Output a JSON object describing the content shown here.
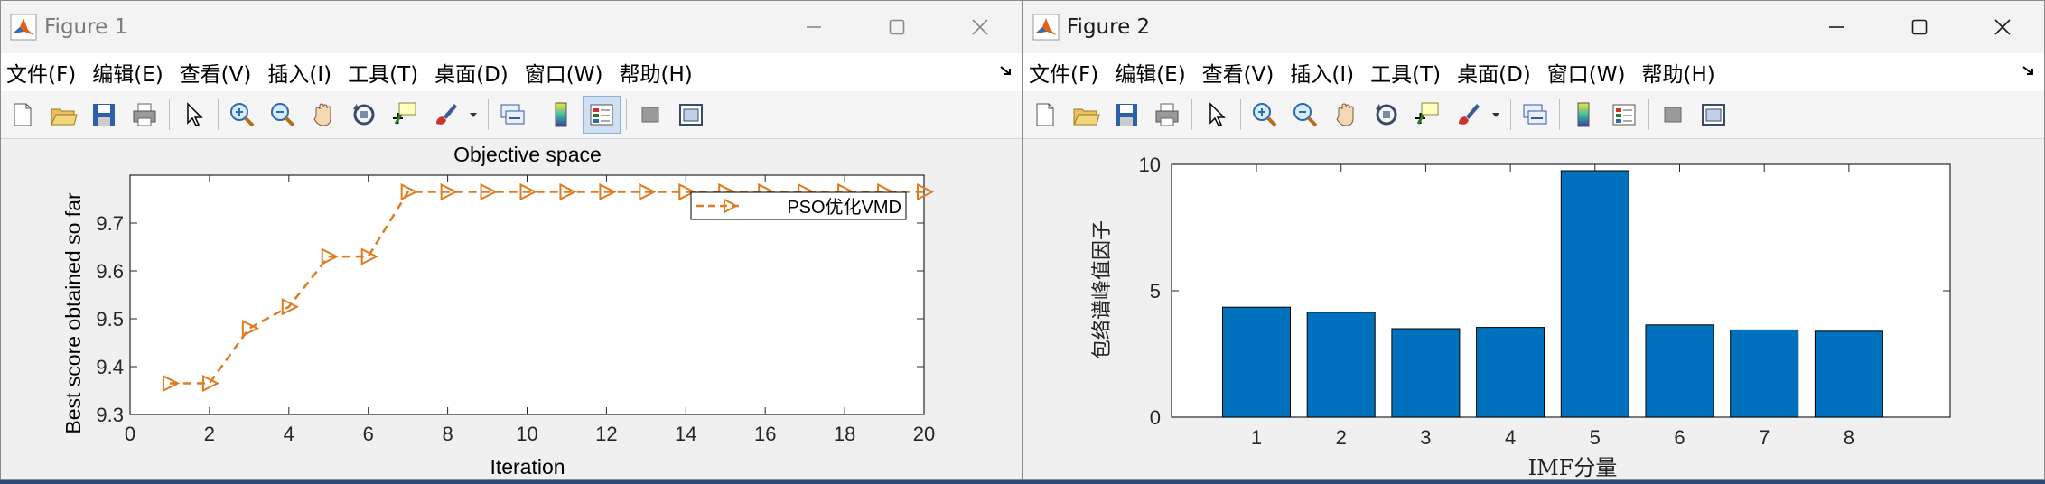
{
  "windows": [
    {
      "title": "Figure 1",
      "menu": [
        "文件(F)",
        "编辑(E)",
        "查看(V)",
        "插入(I)",
        "工具(T)",
        "桌面(D)",
        "窗口(W)",
        "帮助(H)"
      ],
      "toolbar_icons": [
        "new-figure-icon",
        "open-file-icon",
        "save-icon",
        "print-icon",
        "pointer-icon",
        "zoom-in-icon",
        "zoom-out-icon",
        "pan-icon",
        "rotate-3d-icon",
        "data-cursor-icon",
        "brush-icon",
        "link-plot-icon",
        "colorbar-icon",
        "legend-icon",
        "hide-plot-tools-icon",
        "show-plot-tools-icon"
      ]
    },
    {
      "title": "Figure 2",
      "menu": [
        "文件(F)",
        "编辑(E)",
        "查看(V)",
        "插入(I)",
        "工具(T)",
        "桌面(D)",
        "窗口(W)",
        "帮助(H)"
      ],
      "toolbar_icons": [
        "new-figure-icon",
        "open-file-icon",
        "save-icon",
        "print-icon",
        "pointer-icon",
        "zoom-in-icon",
        "zoom-out-icon",
        "pan-icon",
        "rotate-3d-icon",
        "data-cursor-icon",
        "brush-icon",
        "link-plot-icon",
        "colorbar-icon",
        "legend-icon",
        "hide-plot-tools-icon",
        "show-plot-tools-icon"
      ]
    }
  ],
  "colors": {
    "line_orange": "#e07b20",
    "bar_blue": "#0072bd",
    "pressed_bg": "#cfe0f3"
  },
  "chart_data": [
    {
      "type": "line",
      "title": "Objective space",
      "xlabel": "Iteration",
      "ylabel": "Best score obtained so far",
      "xlim": [
        0,
        20
      ],
      "ylim": [
        9.3,
        9.8
      ],
      "xticks": [
        0,
        2,
        4,
        6,
        8,
        10,
        12,
        14,
        16,
        18,
        20
      ],
      "yticks": [
        9.3,
        9.4,
        9.5,
        9.6,
        9.7
      ],
      "legend_position": "top-right",
      "series": [
        {
          "name": "PSO优化VMD",
          "x": [
            1,
            2,
            3,
            4,
            5,
            6,
            7,
            8,
            9,
            10,
            11,
            12,
            13,
            14,
            15,
            16,
            17,
            18,
            19,
            20
          ],
          "values": [
            9.365,
            9.365,
            9.48,
            9.525,
            9.63,
            9.63,
            9.765,
            9.765,
            9.765,
            9.765,
            9.765,
            9.765,
            9.765,
            9.765,
            9.765,
            9.765,
            9.765,
            9.765,
            9.765,
            9.765
          ]
        }
      ]
    },
    {
      "type": "bar",
      "title": "",
      "xlabel": "IMF分量",
      "ylabel": "包络谱峰值因子",
      "categories": [
        "1",
        "2",
        "3",
        "4",
        "5",
        "6",
        "7",
        "8"
      ],
      "values": [
        4.35,
        4.15,
        3.5,
        3.55,
        9.75,
        3.65,
        3.45,
        3.4
      ],
      "ylim": [
        0,
        10
      ],
      "yticks": [
        0,
        5,
        10
      ]
    }
  ]
}
